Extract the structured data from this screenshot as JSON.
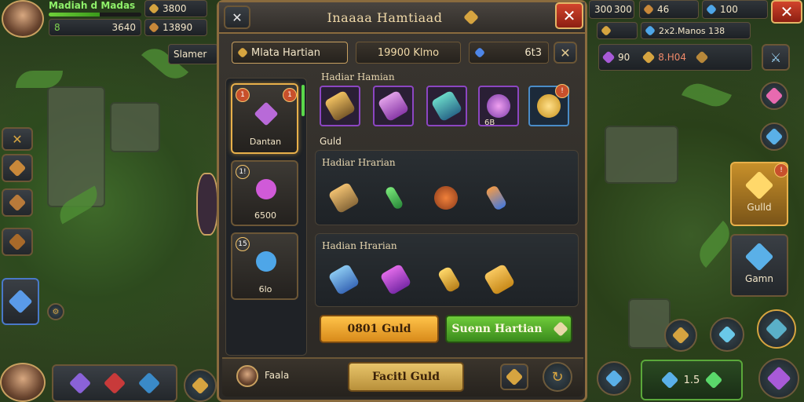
{
  "player": {
    "name": "Madiah d Madas",
    "level_text": "8",
    "power": "3640",
    "xp_progress": 0.55
  },
  "top_left": {
    "resource1": "3800",
    "resource2": "13890",
    "chip_label": "Slamer"
  },
  "top_right": {
    "counter1": "300",
    "counter2": "300",
    "counter3": "100",
    "resource_a": "46",
    "status_text": "2x2.Manos 138",
    "stat1": "90",
    "stat2": "8.H04"
  },
  "panel": {
    "title": "Inaaaa Hamtiaad",
    "tab_label": "Mlata Hartian",
    "tab_value": "19900 Klmo",
    "currency_value": "6t3",
    "left_cards": [
      {
        "name": "Dantan",
        "badge_left": "1",
        "badge_right": "1",
        "icon": "gauntlet-icon"
      },
      {
        "name": "6500",
        "badge_left": "1!",
        "icon": "spiked-orb-purple-icon"
      },
      {
        "name": "6lo",
        "badge_left": "15",
        "icon": "spiked-orb-blue-icon"
      }
    ],
    "section1": {
      "title": "Hadiar Hamian",
      "sub_label": "Guld",
      "slot_label": "6B",
      "items": [
        {
          "icon": "drill-item-icon",
          "frame": "purple"
        },
        {
          "icon": "crate-item-icon",
          "frame": "purple"
        },
        {
          "icon": "capsule-item-icon",
          "frame": "purple"
        },
        {
          "icon": "ring-item-icon",
          "frame": "purple"
        },
        {
          "icon": "gold-shield-item-icon",
          "frame": "blue"
        }
      ]
    },
    "section2": {
      "title": "Hadiar Hrarian",
      "items": [
        "chest-item-icon",
        "wand-item-icon",
        "amulet-item-icon",
        "rocket-item-icon"
      ]
    },
    "section3": {
      "title": "Hadian Hrarian",
      "items": [
        "blue-cube-item-icon",
        "purple-crystal-item-icon",
        "gold-shard-item-icon",
        "gold-nugget-item-icon"
      ]
    },
    "buttons": {
      "gold": "0801 Guld",
      "green": "Suenn Hartian",
      "bottom": "Facitl Guld"
    },
    "footer_label": "Faala"
  },
  "right_side": {
    "card1_label": "Gulld",
    "card2_label": "Gamn",
    "bottom_counter": "1.5"
  },
  "colors": {
    "accent_gold": "#e8b04a",
    "close_red": "#d2442c",
    "confirm_green": "#6fcc3a"
  }
}
